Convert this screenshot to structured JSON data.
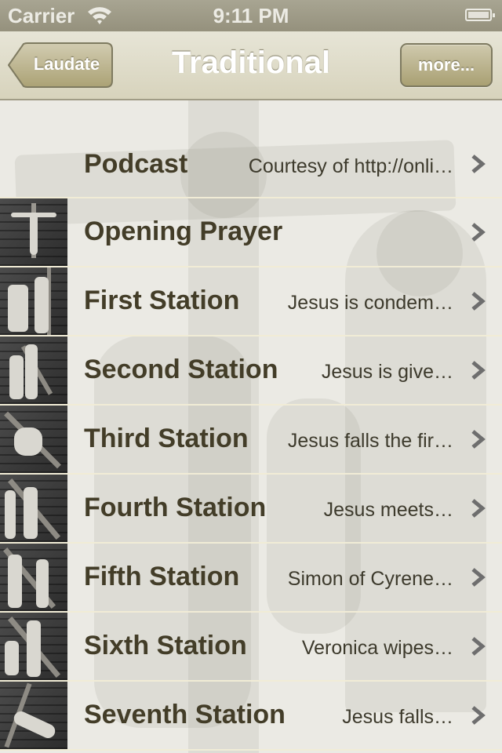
{
  "status_bar": {
    "carrier": "Carrier",
    "time": "9:11 PM",
    "wifi_icon": "wifi-icon",
    "battery_icon": "battery-icon"
  },
  "nav_bar": {
    "title": "Traditional",
    "back_label": "Laudate",
    "right_label": "more..."
  },
  "colors": {
    "nav_tint": "#d7d3bc",
    "button_tint": "#a9a073",
    "title_text": "#433d28",
    "separator": "#f1ecd6",
    "chevron": "#6e6e6e"
  },
  "rows": [
    {
      "title": "Podcast",
      "detail": "Courtesy of http://onli…",
      "has_thumb": false
    },
    {
      "title": "Opening Prayer",
      "detail": "",
      "has_thumb": true,
      "thumb": "crucifix-thumbnail"
    },
    {
      "title": "First Station",
      "detail": "Jesus is condem…",
      "has_thumb": true,
      "thumb": "station-1-thumbnail"
    },
    {
      "title": "Second Station",
      "detail": "Jesus is give…",
      "has_thumb": true,
      "thumb": "station-2-thumbnail"
    },
    {
      "title": "Third Station",
      "detail": "Jesus falls the fir…",
      "has_thumb": true,
      "thumb": "station-3-thumbnail"
    },
    {
      "title": "Fourth Station",
      "detail": "Jesus meets…",
      "has_thumb": true,
      "thumb": "station-4-thumbnail"
    },
    {
      "title": "Fifth Station",
      "detail": "Simon of Cyrene…",
      "has_thumb": true,
      "thumb": "station-5-thumbnail"
    },
    {
      "title": "Sixth Station",
      "detail": "Veronica wipes…",
      "has_thumb": true,
      "thumb": "station-6-thumbnail"
    },
    {
      "title": "Seventh Station",
      "detail": "Jesus falls…",
      "has_thumb": true,
      "thumb": "station-7-thumbnail"
    }
  ]
}
